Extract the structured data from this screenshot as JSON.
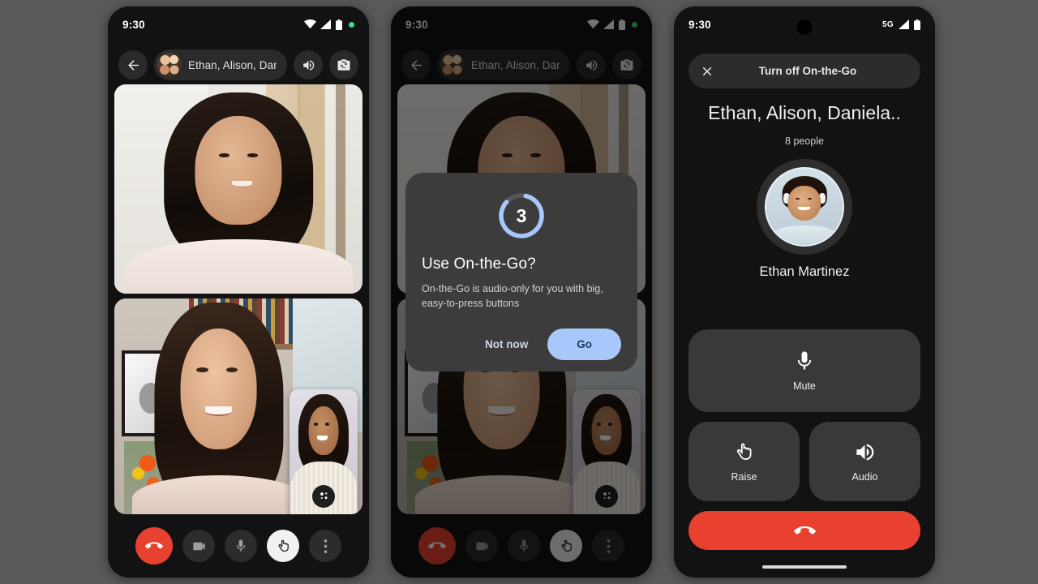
{
  "background_color": "#595959",
  "accent_colors": {
    "blue": "#A8C7FA",
    "blue_text": "#1B3A66",
    "end_call_red": "#E8412F",
    "surface": "#2C2C2E",
    "dialog_surface": "#3C3C3C",
    "screen_bg": "#121212"
  },
  "phone1": {
    "name": "call-grid-screen",
    "status_bar": {
      "time": "9:30",
      "icons": [
        "wifi-icon",
        "signal-icon",
        "battery-icon",
        "recording-dot-icon"
      ]
    },
    "header": {
      "back_icon": "back-arrow-icon",
      "group_avatar": "group-avatar",
      "title": "Ethan, Alison, Dani...",
      "speaker_icon": "speaker-icon",
      "flip_camera_icon": "flip-camera-icon"
    },
    "tiles": [
      {
        "label": "participant-tile-1"
      },
      {
        "label": "participant-tile-2"
      }
    ],
    "self_view": {
      "effects_icon": "effects-sparkle-icon"
    },
    "controls": [
      {
        "name": "end-call-button",
        "icon": "end-call-icon",
        "style": "end"
      },
      {
        "name": "camera-button",
        "icon": "camera-icon",
        "style": "normal"
      },
      {
        "name": "microphone-button",
        "icon": "microphone-icon",
        "style": "normal"
      },
      {
        "name": "raise-hand-button",
        "icon": "raise-hand-icon",
        "style": "active"
      },
      {
        "name": "more-options-button",
        "icon": "more-vertical-icon",
        "style": "normal"
      }
    ]
  },
  "phone2": {
    "name": "on-the-go-prompt-screen",
    "status_bar": {
      "time": "9:30",
      "icons": [
        "wifi-icon",
        "signal-icon",
        "battery-icon",
        "recording-dot-icon"
      ]
    },
    "header": {
      "back_icon": "back-arrow-icon",
      "title": "Ethan, Alison, Dani...",
      "speaker_icon": "speaker-icon",
      "flip_camera_icon": "flip-camera-icon"
    },
    "dialog": {
      "countdown": "3",
      "countdown_progress_degrees": 300,
      "title": "Use On-the-Go?",
      "body": "On-the-Go is audio-only for you with big, easy-to-press buttons",
      "dismiss_label": "Not now",
      "confirm_label": "Go"
    },
    "controls": [
      {
        "name": "end-call-button",
        "icon": "end-call-icon",
        "style": "end"
      },
      {
        "name": "camera-button",
        "icon": "camera-icon",
        "style": "normal"
      },
      {
        "name": "microphone-button",
        "icon": "microphone-icon",
        "style": "normal"
      },
      {
        "name": "raise-hand-button",
        "icon": "raise-hand-icon",
        "style": "active"
      },
      {
        "name": "more-options-button",
        "icon": "more-vertical-icon",
        "style": "normal"
      }
    ]
  },
  "phone3": {
    "name": "on-the-go-active-screen",
    "status_bar": {
      "time": "9:30",
      "network": "5G",
      "icons": [
        "signal-icon",
        "battery-icon"
      ]
    },
    "turn_off_bar": {
      "close_icon": "close-icon",
      "label": "Turn off On-the-Go"
    },
    "call_title": "Ethan, Alison, Daniela..",
    "participant_count": "8 people",
    "active_speaker": {
      "avatar": "ethan-avatar",
      "name": "Ethan Martinez"
    },
    "buttons": [
      {
        "name": "mute-button",
        "icon": "microphone-icon",
        "label": "Mute"
      },
      {
        "name": "raise-hand-button",
        "icon": "raise-hand-icon",
        "label": "Raise"
      },
      {
        "name": "audio-button",
        "icon": "speaker-icon",
        "label": "Audio"
      }
    ],
    "end_call": {
      "name": "end-call-button",
      "icon": "end-call-icon"
    }
  }
}
